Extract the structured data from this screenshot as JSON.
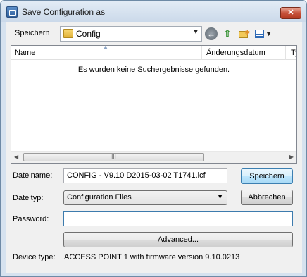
{
  "window": {
    "title": "Save Configuration as",
    "close_glyph": "✕"
  },
  "location": {
    "label": "Speichern",
    "folder": "Config"
  },
  "icons": {
    "back": "back-arrow-icon",
    "up": "up-folder-icon",
    "new_folder": "new-folder-icon",
    "views": "views-menu-icon"
  },
  "list": {
    "columns": [
      "Name",
      "Änderungsdatum",
      "Ty"
    ],
    "empty_message": "Es wurden keine Suchergebnisse gefunden."
  },
  "form": {
    "filename_label": "Dateiname:",
    "filename_value": "CONFIG - V9.10 D2015-03-02 T1741.lcf",
    "filetype_label": "Dateityp:",
    "filetype_value": "Configuration Files",
    "password_label": "Password:",
    "password_value": "",
    "advanced_label": "Advanced...",
    "device_label": "Device type:",
    "device_value": "ACCESS POINT 1  with firmware version 9.10.0213"
  },
  "buttons": {
    "save": "Speichern",
    "cancel": "Abbrechen"
  },
  "colors": {
    "accent": "#3c7fb1",
    "close": "#c7533b"
  }
}
